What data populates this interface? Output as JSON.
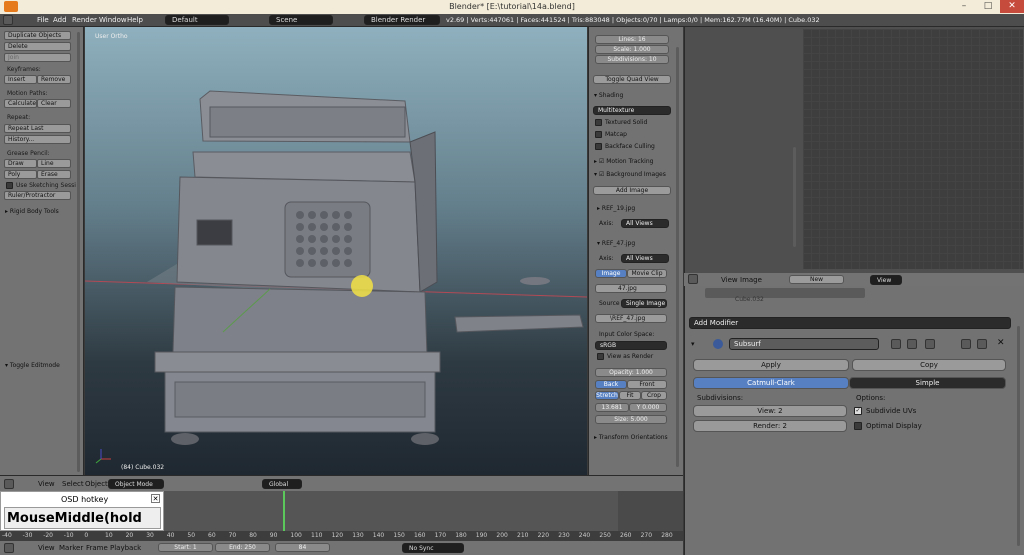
{
  "window": {
    "title": "Blender* [E:\\tutorial\\14a.blend]"
  },
  "infobar": {
    "menus": [
      "File",
      "Add",
      "Render",
      "Window",
      "Help"
    ],
    "layout": "Default",
    "scene": "Scene",
    "engine": "Blender Render",
    "stats": "v2.69 | Verts:447061 | Faces:441524 | Tris:883048 | Objects:0/70 | Lamps:0/0 | Mem:162.77M (16.40M) | Cube.032"
  },
  "toolshelf": {
    "duplicate": "Duplicate Objects",
    "delete": "Delete",
    "join": "Join",
    "keyframes_label": "Keyframes:",
    "insert": "Insert",
    "remove": "Remove",
    "motion_paths_label": "Motion Paths:",
    "calculate": "Calculate",
    "clear": "Clear",
    "repeat_label": "Repeat:",
    "repeat_last": "Repeat Last",
    "history": "History...",
    "grease_label": "Grease Pencil:",
    "draw": "Draw",
    "line": "Line",
    "poly": "Poly",
    "erase": "Erase",
    "use_sketching": "Use Sketching Sessi",
    "ruler": "Ruler/Protractor",
    "rigid_body": "Rigid Body Tools",
    "toggle_editmode": "Toggle Editmode"
  },
  "viewport": {
    "view_label": "User Ortho",
    "object_label": "(84) Cube.032"
  },
  "npanel": {
    "lines": "Lines: 16",
    "scale": "Scale: 1.000",
    "subdivisions": "Subdivisions: 10",
    "toggle_quad": "Toggle Quad View",
    "shading": "Shading",
    "multitexture": "Multitexture",
    "textured_solid": "Textured Solid",
    "matcap": "Matcap",
    "backface": "Backface Culling",
    "motion_tracking": "Motion Tracking",
    "background_images": "Background Images",
    "add_image": "Add Image",
    "ref19": "REF_19.jpg",
    "axis": "Axis:",
    "all_views": "All Views",
    "ref47": "REF_47.jpg",
    "image_tab": "Image",
    "movie_tab": "Movie Clip",
    "img_name": "47.jpg",
    "source": "Source",
    "single_image": "Single Image",
    "path": "\\REF_47.jpg",
    "input_cs": "Input Color Space:",
    "srgb": "sRGB",
    "view_as_render": "View as Render",
    "opacity": "Opacity: 1.000",
    "back": "Back",
    "front": "Front",
    "stretch": "Stretch",
    "fit": "Fit",
    "crop": "Crop",
    "x": "13.681",
    "y": "Y 0.000",
    "size": "Size: 5.000",
    "transform_orient": "Transform Orientations"
  },
  "vp_header": {
    "view": "View",
    "select": "Select",
    "object": "Object",
    "mode": "Object Mode",
    "global": "Global"
  },
  "timeline": {
    "ticks": [
      "-40",
      "-30",
      "-20",
      "-10",
      "0",
      "10",
      "20",
      "30",
      "40",
      "50",
      "60",
      "70",
      "80",
      "90",
      "100",
      "110",
      "120",
      "130",
      "140",
      "150",
      "160",
      "170",
      "180",
      "190",
      "200",
      "210",
      "220",
      "230",
      "240",
      "250",
      "260",
      "270",
      "280"
    ],
    "current_frame_value": 84
  },
  "tl_header": {
    "view": "View",
    "marker": "Marker",
    "frame": "Frame",
    "playback": "Playback",
    "start": "Start: 1",
    "end": "End: 250",
    "current": "84",
    "sync": "No Sync"
  },
  "osd": {
    "title": "OSD hotkey",
    "text": "MouseMiddle(hold"
  },
  "img_header": {
    "view": "View",
    "image": "Image",
    "new": "New",
    "view2": "View"
  },
  "props": {
    "partial": "Cube.032",
    "add_modifier": "Add Modifier",
    "mod_name": "Subsurf",
    "apply": "Apply",
    "copy": "Copy",
    "catmull": "Catmull-Clark",
    "simple": "Simple",
    "subdivisions_label": "Subdivisions:",
    "view_level": "View: 2",
    "render_level": "Render: 2",
    "options_label": "Options:",
    "subdivide_uvs": "Subdivide UVs",
    "optimal_display": "Optimal Display"
  }
}
